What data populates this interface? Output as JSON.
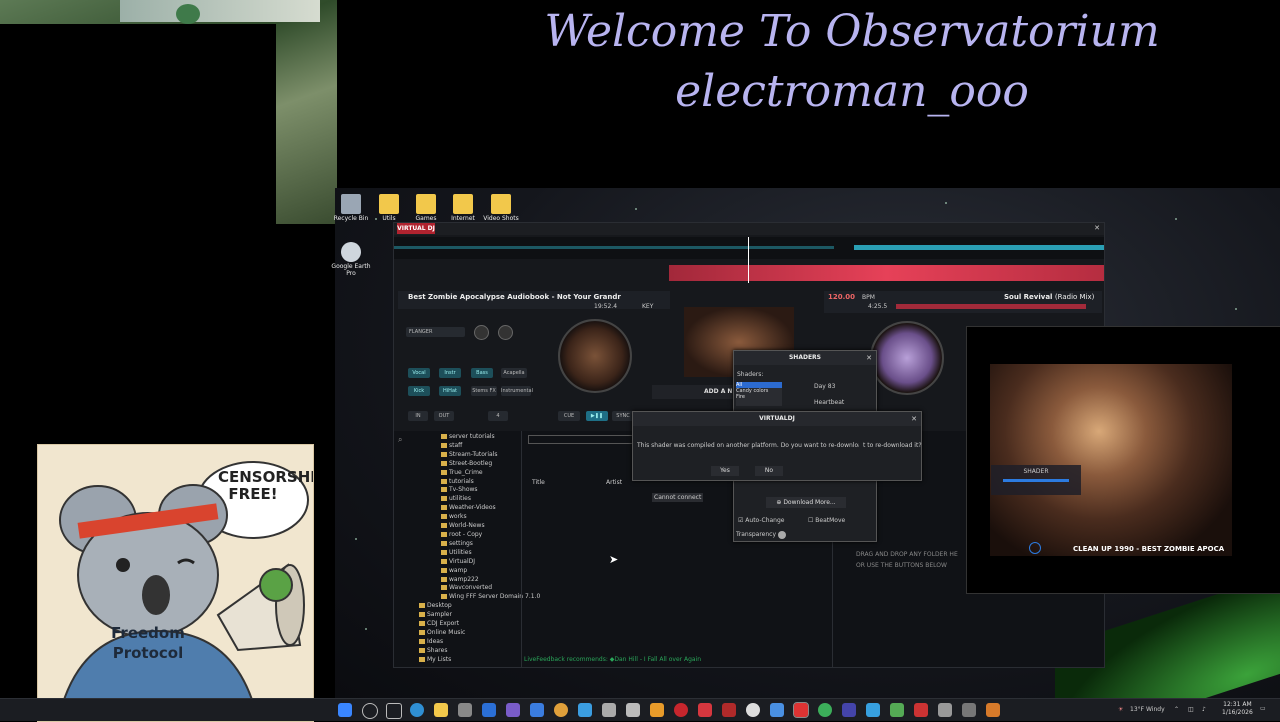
{
  "banner": {
    "line1": "Welcome To Observatorium",
    "line2": "electroman_ooo"
  },
  "desktop_icons": [
    {
      "label": "Recycle Bin",
      "color": "#9aa6b4"
    },
    {
      "label": "Utils",
      "color": "#f2c84b"
    },
    {
      "label": "Games",
      "color": "#f2c84b"
    },
    {
      "label": "Internet",
      "color": "#f2c84b"
    },
    {
      "label": "Video Shots",
      "color": "#f2c84b"
    },
    {
      "label": "Google Earth Pro",
      "color": "#cfd6dd"
    }
  ],
  "vdj": {
    "logo": "VIRTUAL DJ",
    "deck_left": {
      "title": "Best Zombie Apocalypse Audiobook - Not Your Grandr",
      "time": "19:52.4",
      "key": "KEY",
      "fx": "FLANGER",
      "buttons": [
        "Vocal",
        "Instr",
        "Bass",
        "Acapella",
        "Kick",
        "HiHat",
        "Stems FX",
        "Instrumental"
      ],
      "loop": "4",
      "transport": [
        "IN",
        "OUT",
        "CUE",
        "SYNC"
      ]
    },
    "deck_right": {
      "bpm": "120.00",
      "bpm_unit": "BPM",
      "time": "4:25.5",
      "title": "Soul Revival",
      "mix": "(Radio Mix)"
    },
    "add_label": "ADD A N",
    "folder_tree": [
      "server tutorials",
      "staff",
      "Stream-Tutorials",
      "Street-Bootleg",
      "True_Crime",
      "tutorials",
      "Tv-Shows",
      "utilities",
      "Weather-Videos",
      "works",
      "World-News",
      "root - Copy",
      "settings",
      "Utilities",
      "VirtualDJ",
      "wamp",
      "wamp222",
      "Wavconverted",
      "Wing FFF Server Domain 7.1.0",
      "Desktop",
      "Sampler",
      "CDJ Export",
      "Online Music",
      "Ideas",
      "Shares",
      "My Lists"
    ],
    "columns": {
      "title": "Title",
      "artist": "Artist"
    },
    "drag_hint1": "DRAG AND DROP ANY FOLDER HE",
    "drag_hint2": "OR USE THE BUTTONS BELOW",
    "live_feedback": "LiveFeedback recommends: ◆Dan Hill - I Fall All over Again",
    "cannot_connect": "Cannot connect"
  },
  "shaders_dialog": {
    "title": "SHADERS",
    "shaders_label": "Shaders:",
    "categories": [
      "All",
      "Candy colors",
      "Fire"
    ],
    "items": [
      "Day 83",
      "Heartbeat"
    ],
    "download_label": "Download More...",
    "auto_change": "Auto-Change",
    "beatmove": "BeatMove",
    "transparency": "Transparency"
  },
  "vdj_dialog": {
    "title": "VIRTUALDJ",
    "message": "This shader was compiled on another platform. Do you want to re-download it?",
    "overflow": "t to re-download it?",
    "yes": "Yes",
    "no": "No"
  },
  "preview": {
    "shader_label": "SHADER",
    "ticker": "CLEAN UP 1990 - BEST ZOMBIE APOCA"
  },
  "koala": {
    "bubble_line1": "CENSORSHIP",
    "bubble_line2": "FREE!",
    "shirt_line1": "Freedom",
    "shirt_line2": "Protocol"
  },
  "taskbar": {
    "weather": "13°F Windy",
    "time": "12:31 AM",
    "date": "1/16/2026"
  }
}
